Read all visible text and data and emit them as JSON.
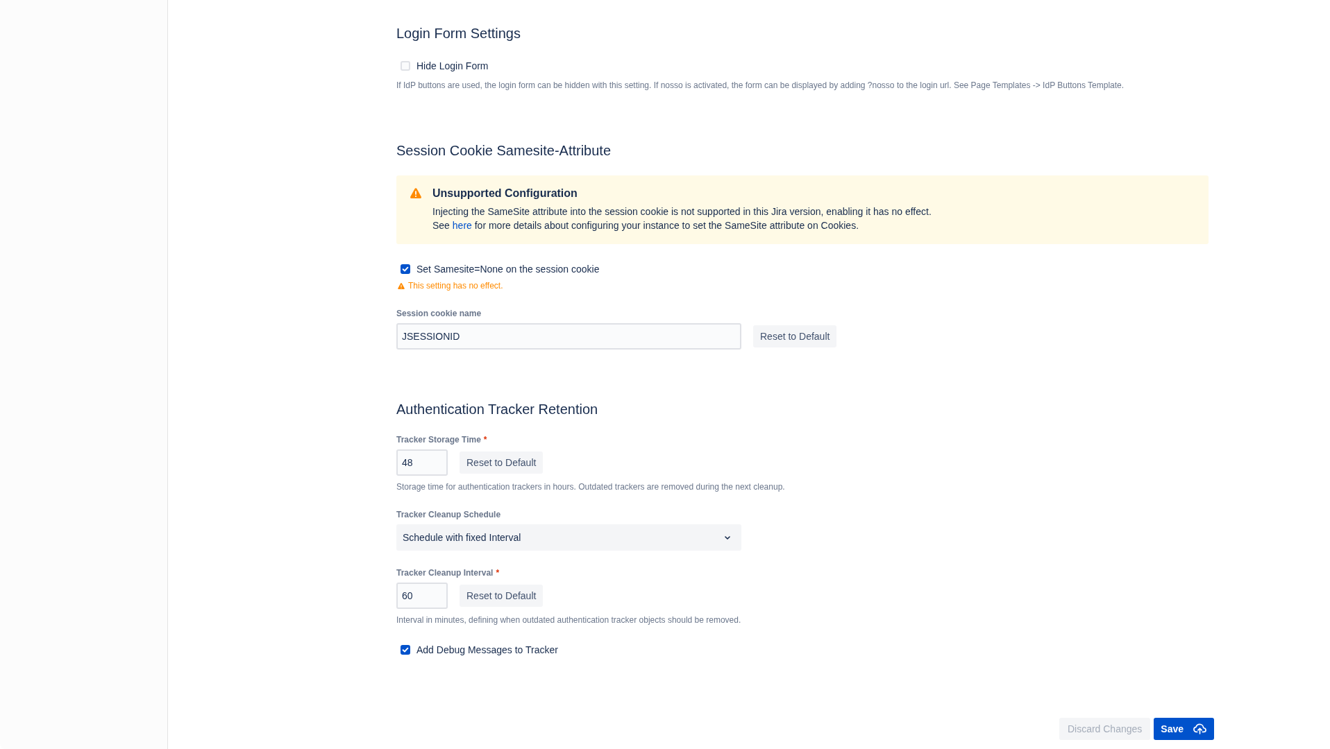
{
  "sections": [
    {
      "title": "Login Form Settings",
      "fields": [
        {
          "kind": "checkbox",
          "label": "Hide Login Form",
          "checked": false,
          "help": "If IdP buttons are used, the login form can be hidden with this setting. If nosso is activated, the form can be displayed by adding ?nosso to the login url. See Page Templates -> IdP Buttons Template."
        }
      ]
    },
    {
      "title": "Session Cookie Samesite-Attribute",
      "fields": [
        {
          "kind": "alert",
          "title": "Unsupported Configuration",
          "text": "Injecting the SameSite attribute into the session cookie is not supported in this Jira version, enabling it has no effect.",
          "before_link": "See",
          "link": "here",
          "after_link": "for more details about configuring your instance to set the SameSite attribute on Cookies."
        },
        {
          "kind": "checkbox",
          "label": "Set Samesite=None on the session cookie",
          "checked": true,
          "warning": "This setting has no effect."
        },
        {
          "kind": "text",
          "label": "Session cookie name",
          "value": "JSESSIONID",
          "reset": "Reset to Default"
        }
      ]
    },
    {
      "title": "Authentication Tracker Retention",
      "fields": [
        {
          "kind": "number",
          "label": "Tracker Storage Time",
          "required_mark": "*",
          "value": "48",
          "reset": "Reset to Default",
          "help": "Storage time for authentication trackers in hours. Outdated trackers are removed during the next cleanup."
        },
        {
          "kind": "select",
          "label": "Tracker Cleanup Schedule",
          "value": "Schedule with fixed Interval"
        },
        {
          "kind": "number",
          "label": "Tracker Cleanup Interval",
          "required_mark": "*",
          "value": "60",
          "reset": "Reset to Default",
          "help": "Interval in minutes, defining when outdated authentication tracker objects should be removed."
        },
        {
          "kind": "checkbox",
          "label": "Add Debug Messages to Tracker",
          "checked": true
        }
      ]
    }
  ],
  "footer": {
    "buttons": [
      {
        "kind": "secondary",
        "label": "Discard Changes",
        "disabled": true
      },
      {
        "kind": "primary",
        "label": "Save",
        "disabled": false
      }
    ]
  }
}
